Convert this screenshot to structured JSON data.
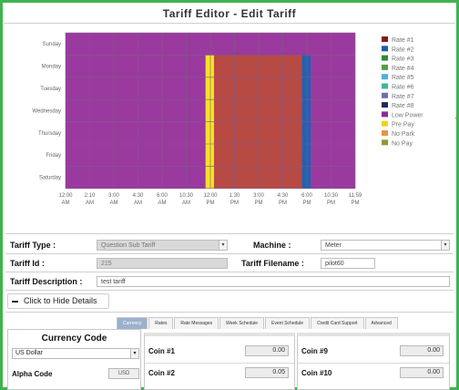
{
  "page": {
    "title": "Tariff Editor - Edit Tariff"
  },
  "chart_data": {
    "type": "heatmap",
    "days": [
      "Sunday",
      "Monday",
      "Tuesday",
      "Wednesday",
      "Thursday",
      "Friday",
      "Saturday"
    ],
    "x_ticks": [
      {
        "top": "12:00",
        "bottom": "AM"
      },
      {
        "top": "2:10",
        "bottom": "AM"
      },
      {
        "top": "3:00",
        "bottom": "AM"
      },
      {
        "top": "4:30",
        "bottom": "AM"
      },
      {
        "top": "6:00",
        "bottom": "AM"
      },
      {
        "top": "10:30",
        "bottom": "AM"
      },
      {
        "top": "12:00",
        "bottom": "PM"
      },
      {
        "top": "1:30",
        "bottom": "PM"
      },
      {
        "top": "3:00",
        "bottom": "PM"
      },
      {
        "top": "4:30",
        "bottom": "PM"
      },
      {
        "top": "6:00",
        "bottom": "PM"
      },
      {
        "top": "10:30",
        "bottom": "PM"
      },
      {
        "top": "11:59",
        "bottom": "PM"
      }
    ],
    "legend": [
      {
        "name": "Rate #1",
        "color": "#8b1a1a"
      },
      {
        "name": "Rate #2",
        "color": "#1f5fa8"
      },
      {
        "name": "Rate #3",
        "color": "#2e8b3a"
      },
      {
        "name": "Rate #4",
        "color": "#5a9a4a"
      },
      {
        "name": "Rate #5",
        "color": "#4fb0e0"
      },
      {
        "name": "Rate #6",
        "color": "#3cb6a4"
      },
      {
        "name": "Rate #7",
        "color": "#6a6fb5"
      },
      {
        "name": "Rate #8",
        "color": "#1c2a5e"
      },
      {
        "name": "Low Power",
        "color": "#8a2b9a"
      },
      {
        "name": "Pre Pay",
        "color": "#f0d21e"
      },
      {
        "name": "No Park",
        "color": "#e8944a"
      },
      {
        "name": "No Pay",
        "color": "#8f9a32"
      }
    ],
    "colors": {
      "low_power": "#9a3a9e",
      "rate1": "#b84a44",
      "pre_pay": "#f6e12a",
      "rate2": "#1e62b4",
      "grid": "#7f5a88"
    },
    "block_hours": {
      "rate1_weekday_start": 12.3,
      "rate1_weekday_end": 19.6,
      "prepay_start": 11.6,
      "prepay_end": 12.3,
      "rate2_start": 19.6,
      "rate2_end": 20.3,
      "axis_end": 24,
      "weekday_rows": [
        1,
        2,
        3,
        4,
        5,
        6
      ],
      "marker_rows": [
        1,
        2,
        3,
        4,
        5,
        6
      ]
    }
  },
  "form": {
    "tariff_type_label": "Tariff Type :",
    "tariff_type_value": "Question Sub Tariff",
    "machine_label": "Machine :",
    "machine_value": "Meter",
    "tariff_id_label": "Tariff Id :",
    "tariff_id_value": "215",
    "tariff_filename_label": "Tariff Filename :",
    "tariff_filename_value": "pilot60",
    "tariff_description_label": "Tariff Description :",
    "tariff_description_value": "test tariff"
  },
  "hide_details_label": "Click to Hide Details",
  "tabs": [
    "Currency",
    "Rates",
    "Rate Messages",
    "Week Schedule",
    "Event Schedule",
    "Credit Card Support",
    "Advanced"
  ],
  "currency_panel": {
    "title": "Currency Code",
    "selected": "US Dollar",
    "alpha_label": "Alpha Code",
    "alpha_value": "USD"
  },
  "coins_left": [
    {
      "label": "Coin #1",
      "value": "0.00"
    },
    {
      "label": "Coin #2",
      "value": "0.05"
    }
  ],
  "coins_right": [
    {
      "label": "Coin #9",
      "value": "0.00"
    },
    {
      "label": "Coin #10",
      "value": "0.00"
    }
  ]
}
